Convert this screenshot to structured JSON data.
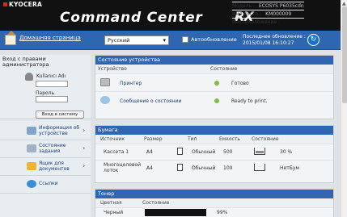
{
  "header": {
    "brand": "KYOCERA",
    "app_title": "Command Center",
    "app_suffix": "RX",
    "meta": [
      {
        "label": "Модель :",
        "value": "ECOSYS P6035cdn"
      },
      {
        "label": "Имя хоста :",
        "value": "KM000009"
      },
      {
        "label": "Местоположение :",
        "value": ""
      }
    ]
  },
  "nav": {
    "home_label": "Домашняя страница",
    "language": "Русский",
    "autoupdate_label": "Автообновление",
    "last_update_label": "Последнее обновление :",
    "last_update_value": "2015/01/08 16:10:27"
  },
  "sidebar": {
    "login_title_1": "Вход с правами",
    "login_title_2": "администратора",
    "user_label": "Kullanıcı Adı",
    "password_label": "Пароль",
    "login_button": "Вход в систему",
    "items": [
      {
        "label_1": "Информация об",
        "label_2": "устройстве",
        "icon": "device-info-icon"
      },
      {
        "label_1": "Состояние",
        "label_2": "задания",
        "icon": "job-status-icon"
      },
      {
        "label_1": "Ящик для",
        "label_2": "документов",
        "icon": "document-box-icon"
      },
      {
        "label_1": "Ссылки",
        "label_2": "",
        "icon": "links-icon"
      }
    ]
  },
  "device_status": {
    "title": "Состояние устройства",
    "col_device": "Устройство",
    "col_state": "Состояние",
    "rows": [
      {
        "name": "Принтер",
        "state": "Готово"
      },
      {
        "name": "Сообщение о состоянии",
        "state": "Ready to print."
      }
    ]
  },
  "paper": {
    "title": "Бумага",
    "cols": [
      "Источник",
      "Размер",
      "Тип",
      "Емкость",
      "Состояние"
    ],
    "rows": [
      {
        "source": "Кассета 1",
        "size": "A4",
        "type": "Обычный",
        "capacity": "500",
        "state": "30 %"
      },
      {
        "source_1": "Многоцелевой",
        "source_2": "лоток",
        "size": "A4",
        "type": "Обычный",
        "capacity": "100",
        "state": "НетБум"
      }
    ]
  },
  "toner": {
    "title": "Тонер",
    "col_color": "Цветная",
    "col_state": "Состояние",
    "rows": [
      {
        "color": "Черный",
        "state": "99%"
      }
    ]
  },
  "colors": {
    "accent": "#2e66b1",
    "ok": "#7bbf3a"
  }
}
